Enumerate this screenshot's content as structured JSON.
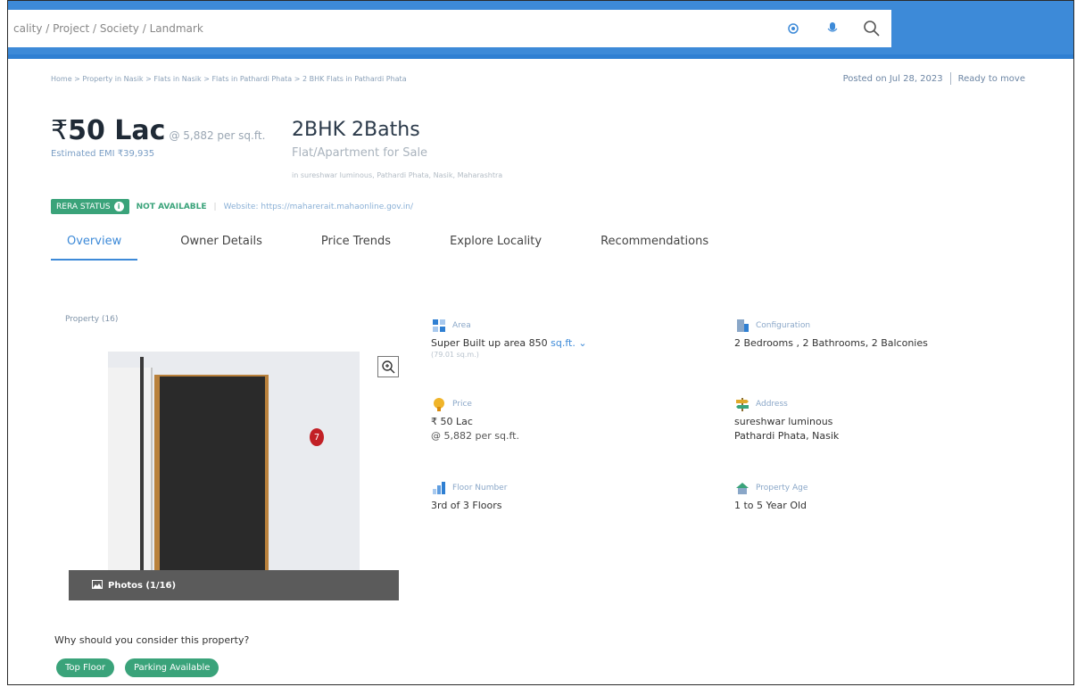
{
  "search": {
    "placeholder": "cality / Project / Society / Landmark"
  },
  "breadcrumb": "Home > Property in Nasik > Flats in Nasik > Flats in Pathardi Phata > 2 BHK Flats in Pathardi Phata",
  "meta": {
    "posted": "Posted on Jul 28, 2023",
    "status": "Ready to move"
  },
  "price": {
    "currency": "₹",
    "amount": "50 Lac",
    "per_sqft": "@ 5,882 per sq.ft.",
    "emi": "Estimated EMI ₹39,935"
  },
  "listing": {
    "title": "2BHK 2Baths",
    "subtitle": "Flat/Apartment for Sale",
    "address": "in sureshwar luminous, Pathardi Phata, Nasik, Maharashtra"
  },
  "rera": {
    "label": "RERA STATUS",
    "value": "NOT AVAILABLE",
    "website": "Website: https://maharerait.mahaonline.gov.in/"
  },
  "tabs": [
    "Overview",
    "Owner Details",
    "Price Trends",
    "Explore Locality",
    "Recommendations"
  ],
  "gallery": {
    "label": "Property (16)",
    "photos_label": "Photos (1/16)"
  },
  "details": {
    "area": {
      "label": "Area",
      "value": "Super Built up area 850",
      "unit": "sq.ft.",
      "sub": "(79.01 sq.m.)"
    },
    "configuration": {
      "label": "Configuration",
      "value": "2 Bedrooms , 2 Bathrooms, 2 Balconies"
    },
    "price": {
      "label": "Price",
      "value": "₹ 50 Lac",
      "sub": "@ 5,882 per sq.ft."
    },
    "address": {
      "label": "Address",
      "line1": "sureshwar luminous",
      "line2": "Pathardi Phata, Nasik"
    },
    "floor": {
      "label": "Floor Number",
      "value": "3rd of 3 Floors"
    },
    "age": {
      "label": "Property Age",
      "value": "1 to 5 Year Old"
    }
  },
  "why": {
    "title": "Why should you consider this property?",
    "chips": [
      "Top Floor",
      "Parking Available"
    ]
  },
  "colors": {
    "brand": "#3d8ad8",
    "green": "#3aa37a"
  }
}
